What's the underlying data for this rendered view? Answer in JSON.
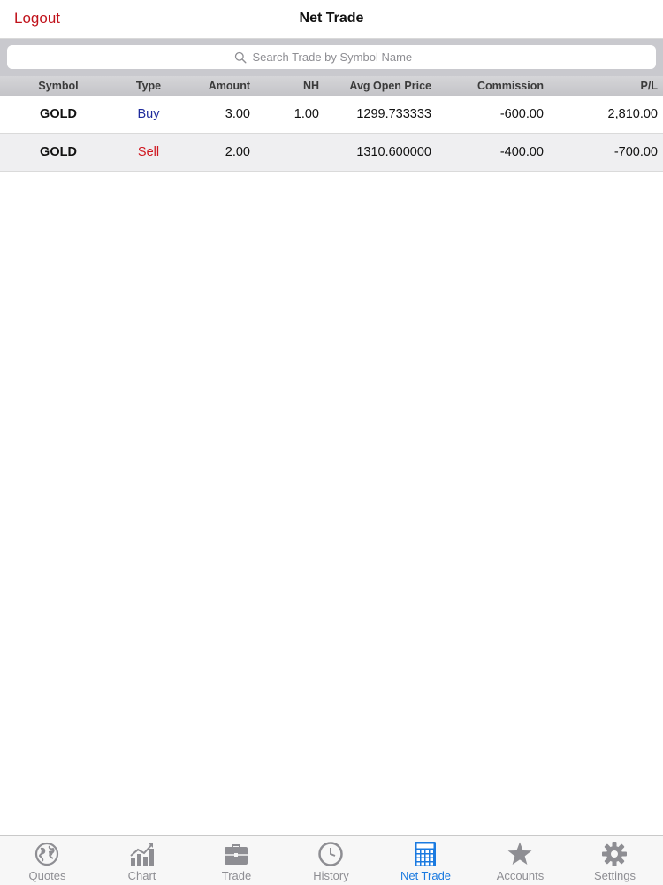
{
  "nav": {
    "left_button": "Logout",
    "title": "Net Trade"
  },
  "search": {
    "placeholder": "Search Trade by Symbol Name",
    "value": ""
  },
  "table": {
    "headers": [
      "Symbol",
      "Type",
      "Amount",
      "NH",
      "Avg Open Price",
      "Commission",
      "P/L"
    ],
    "rows": [
      {
        "symbol": "GOLD",
        "type": "Buy",
        "amount": "3.00",
        "nh": "1.00",
        "avg_open_price": "1299.733333",
        "commission": "-600.00",
        "pl": "2,810.00"
      },
      {
        "symbol": "GOLD",
        "type": "Sell",
        "amount": "2.00",
        "nh": "",
        "avg_open_price": "1310.600000",
        "commission": "-400.00",
        "pl": "-700.00"
      }
    ]
  },
  "colors": {
    "logout": "#c0121b",
    "buy": "#1f2b9c",
    "sell": "#d0161f",
    "tab_active": "#1a7ae0",
    "tab_inactive": "#8e8e93"
  },
  "tabbar": {
    "active": "Net Trade",
    "tabs": [
      {
        "label": "Quotes",
        "icon": "globe-icon"
      },
      {
        "label": "Chart",
        "icon": "bar-chart-icon"
      },
      {
        "label": "Trade",
        "icon": "briefcase-icon"
      },
      {
        "label": "History",
        "icon": "clock-icon"
      },
      {
        "label": "Net Trade",
        "icon": "calculator-icon"
      },
      {
        "label": "Accounts",
        "icon": "star-icon"
      },
      {
        "label": "Settings",
        "icon": "gear-icon"
      }
    ]
  }
}
